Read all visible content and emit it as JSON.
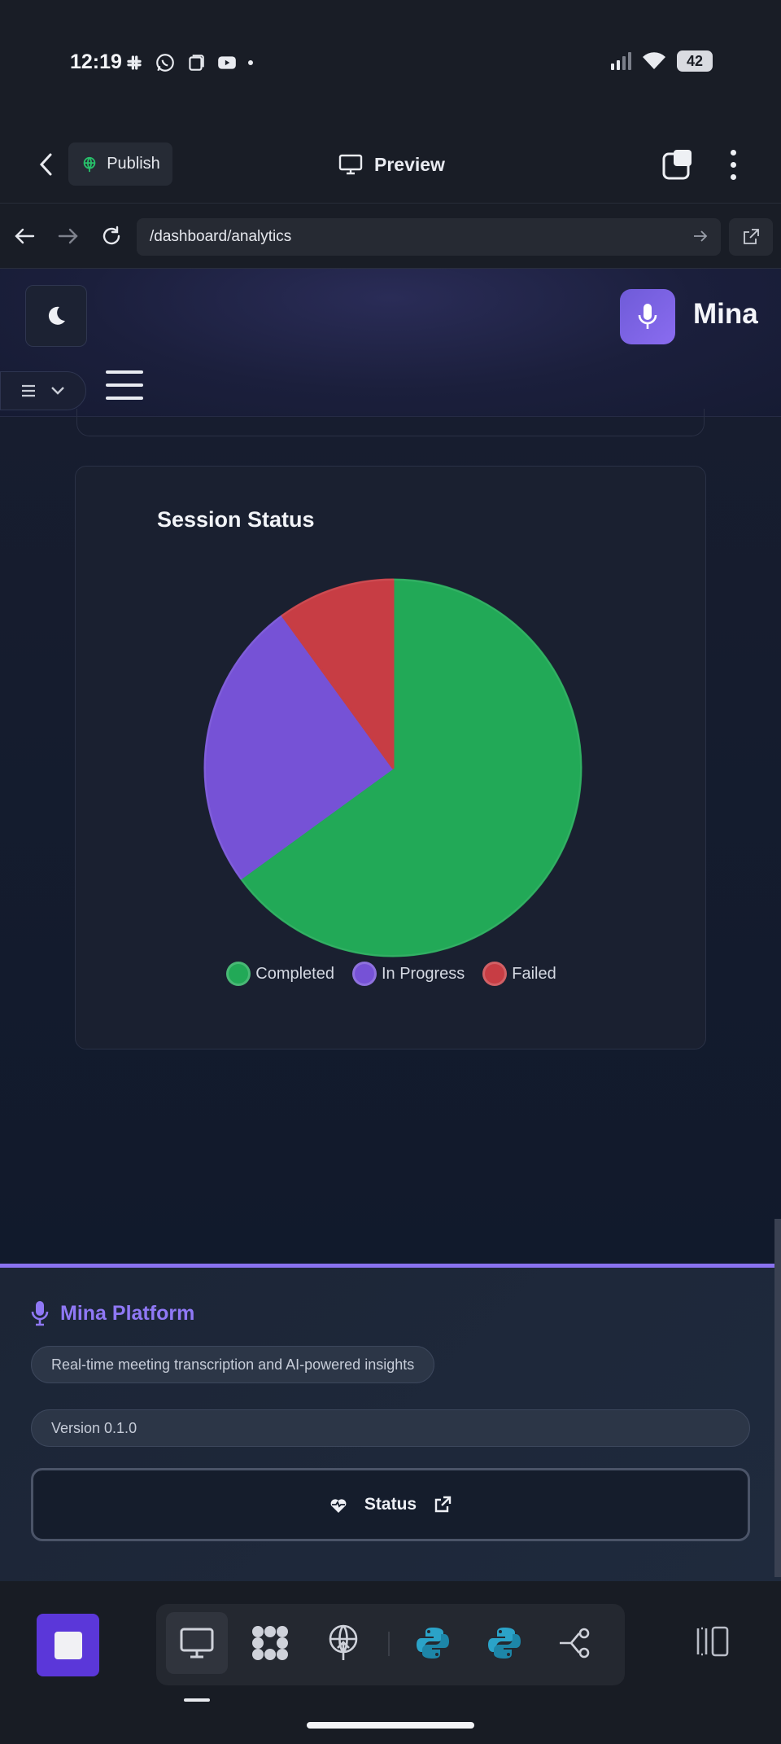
{
  "status_bar": {
    "time": "12:19",
    "battery": "42"
  },
  "toolbar": {
    "publish_label": "Publish",
    "preview_label": "Preview"
  },
  "browser": {
    "url": "/dashboard/analytics"
  },
  "header": {
    "brand": "Mina"
  },
  "chart_section": {
    "title": "Session Status"
  },
  "chart_data": {
    "type": "pie",
    "title": "Session Status",
    "slices": [
      {
        "label": "Completed",
        "value": 65,
        "color": "#22a957"
      },
      {
        "label": "In Progress",
        "value": 25,
        "color": "#7652d6"
      },
      {
        "label": "Failed",
        "value": 10,
        "color": "#c73d44"
      }
    ],
    "legend_position": "bottom"
  },
  "footer": {
    "brand": "Mina Platform",
    "tagline": "Real-time meeting transcription and AI-powered insights",
    "version": "Version 0.1.0",
    "status_label": "Status"
  },
  "colors": {
    "accent": "#8a72f0",
    "completed": "#22a957",
    "in_progress": "#7652d6",
    "failed": "#c73d44"
  },
  "dock": {
    "items": [
      "desktop-icon",
      "grid-apps-icon",
      "deploy-icon",
      "python-icon",
      "python-icon",
      "share-nodes-icon"
    ]
  }
}
